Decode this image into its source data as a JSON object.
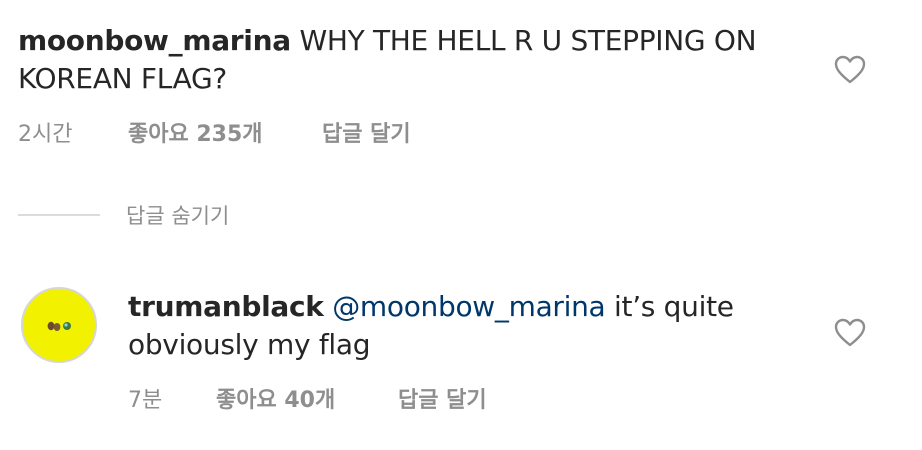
{
  "top_comment": {
    "username": "moonbow_marina",
    "text": "WHY THE HELL R U STEPPING ON KOREAN FLAG?",
    "time": "2시간",
    "likes": "좋아요 235개",
    "reply_label": "답글 달기"
  },
  "hide_replies_label": "답글 숨기기",
  "reply_comment": {
    "username": "trumanblack",
    "mention": "@moonbow_marina",
    "text": "it’s quite obviously my flag",
    "time": "7분",
    "likes": "좋아요 40개",
    "reply_label": "답글 달기"
  },
  "icons": {
    "like": "heart-outline-icon",
    "avatar_background": "#f2f200"
  }
}
